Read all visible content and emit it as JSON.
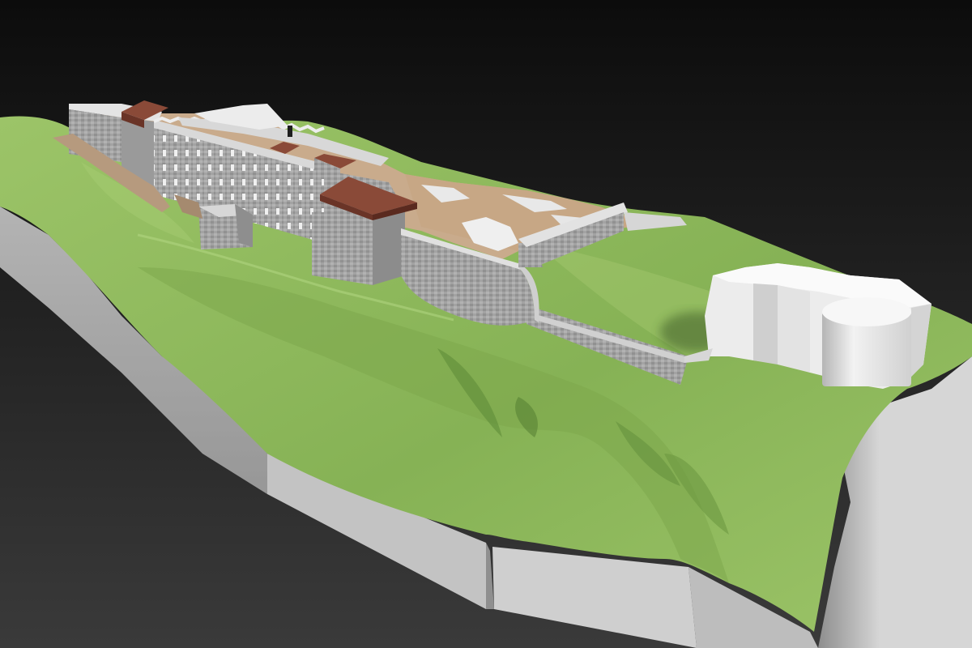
{
  "scene": {
    "subject": "3d-fortress-terrain-model",
    "colors": {
      "background_top": "#0c0c0c",
      "background_bottom": "#3a3a3a",
      "grass_light": "#9cc468",
      "grass_mid": "#86b255",
      "grass_dark": "#5f8c39",
      "cliff_light": "#d6d6d6",
      "cliff_mid": "#b9b9b9",
      "cliff_dark": "#8e8e8e",
      "stone_light": "#bcbcbc",
      "stone_mid": "#a3a3a3",
      "stone_dark": "#808080",
      "roof": "#8a4a38",
      "roof_dark": "#6a3427",
      "courtyard": "#c9ab8c",
      "path": "#b69a7e",
      "placeholder_block": "#efefef",
      "placeholder_shade": "#c9c9c9"
    }
  }
}
